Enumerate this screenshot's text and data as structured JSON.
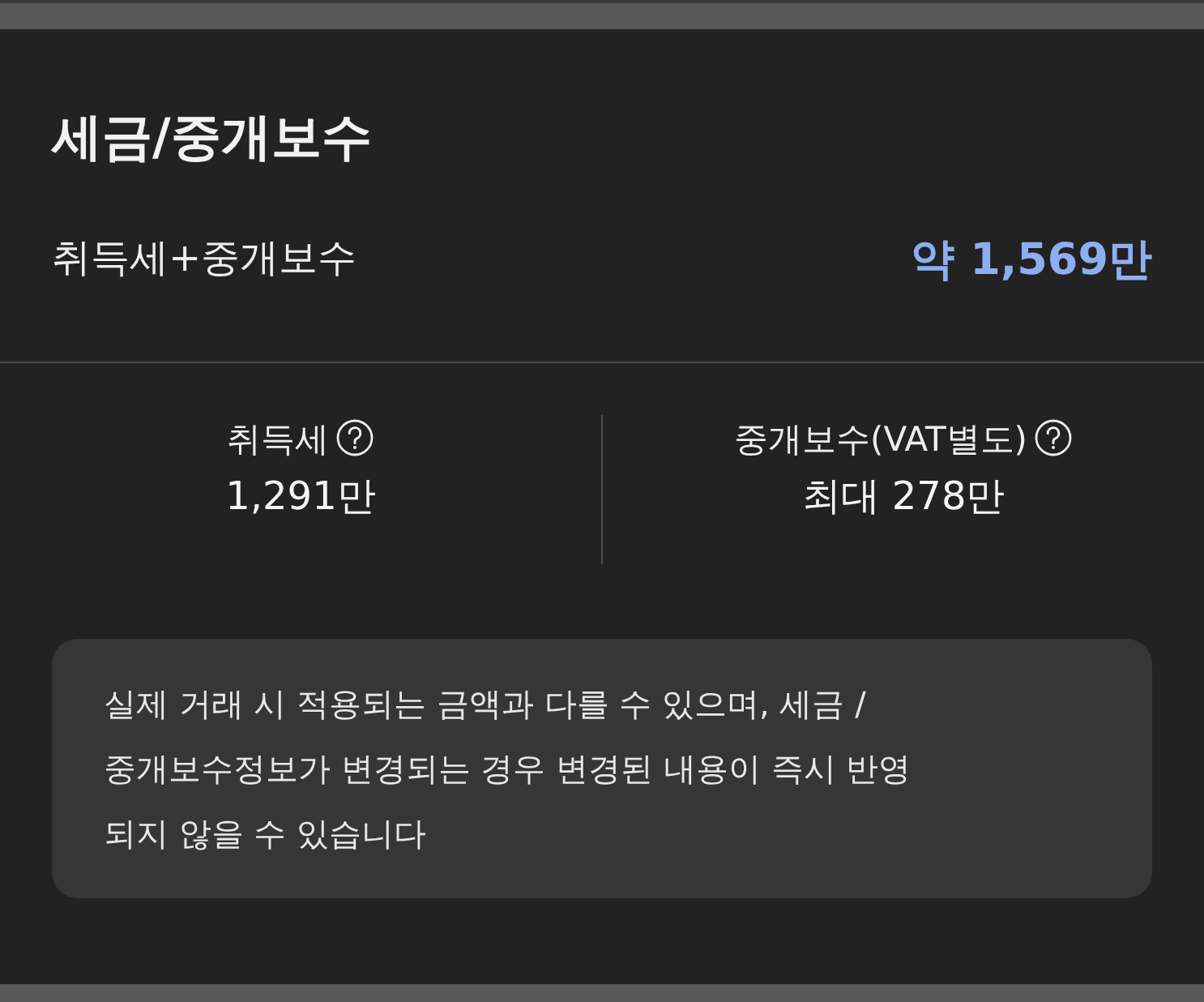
{
  "title": "세금/중개보수",
  "total": {
    "label": "취득세+중개보수",
    "value": "약 1,569만"
  },
  "breakdown": [
    {
      "label": "취득세",
      "value": "1,291만"
    },
    {
      "label": "중개보수(VAT별도)",
      "value": "최대 278만"
    }
  ],
  "notice": {
    "lines": [
      "실제 거래 시 적용되는 금액과 다를 수 있으며, 세금 /",
      "중개보수정보가 변경되는 경우 변경된 내용이 즉시 반영",
      "되지 않을 수 있습니다"
    ]
  }
}
